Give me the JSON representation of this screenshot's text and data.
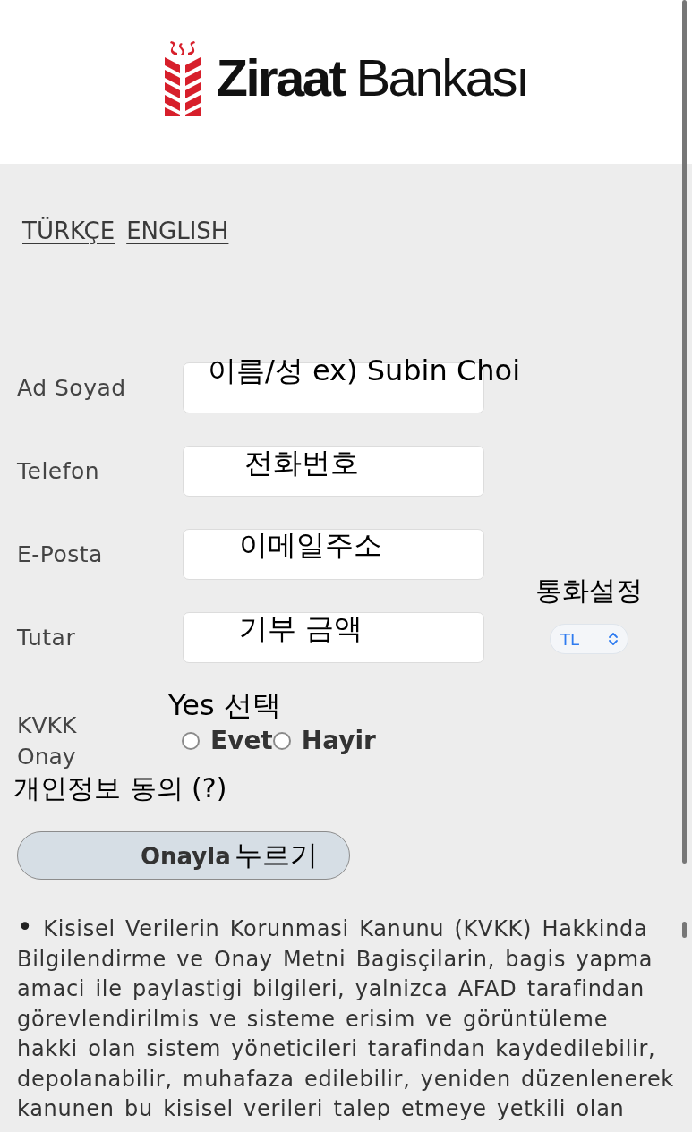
{
  "logo": {
    "name_bold": "Ziraat",
    "name_regular": "Bankası"
  },
  "language_links": [
    {
      "label": "TÜRKÇE"
    },
    {
      "label": "ENGLISH"
    }
  ],
  "form": {
    "fields": [
      {
        "label": "Ad Soyad",
        "annotation": "이름/성 ex) Subin Choi"
      },
      {
        "label": "Telefon",
        "annotation": "전화번호"
      },
      {
        "label": "E-Posta",
        "annotation": "이메일주소"
      },
      {
        "label": "Tutar",
        "annotation": "기부 금액"
      }
    ],
    "currency": {
      "annotation": "통화설정",
      "value": "TL"
    },
    "consent": {
      "label": "KVKK Onay",
      "annotation": "Yes 선택",
      "note": "개인정보 동의 (?)",
      "options": [
        {
          "label": "Evet",
          "selected": false
        },
        {
          "label": "Hayir",
          "selected": false
        }
      ]
    },
    "submit": {
      "label": "Onayla",
      "annotation": "누르기"
    }
  },
  "notice": {
    "bullet": "•",
    "text": "Kisisel Verilerin Korunmasi Kanunu (KVKK) Hakkinda Bilgilendirme ve Onay Metni Bagisçilarin, bagis yapma amaci ile paylastigi bilgileri, yalnizca AFAD tarafindan görevlendirilmis ve sisteme erisim ve görüntüleme hakki olan sistem yöneticileri tarafindan kaydedilebilir, depolanabilir, muhafaza edilebilir, yeniden düzenlenerek kanunen bu kisisel verileri talep etmeye yetkili olan"
  }
}
